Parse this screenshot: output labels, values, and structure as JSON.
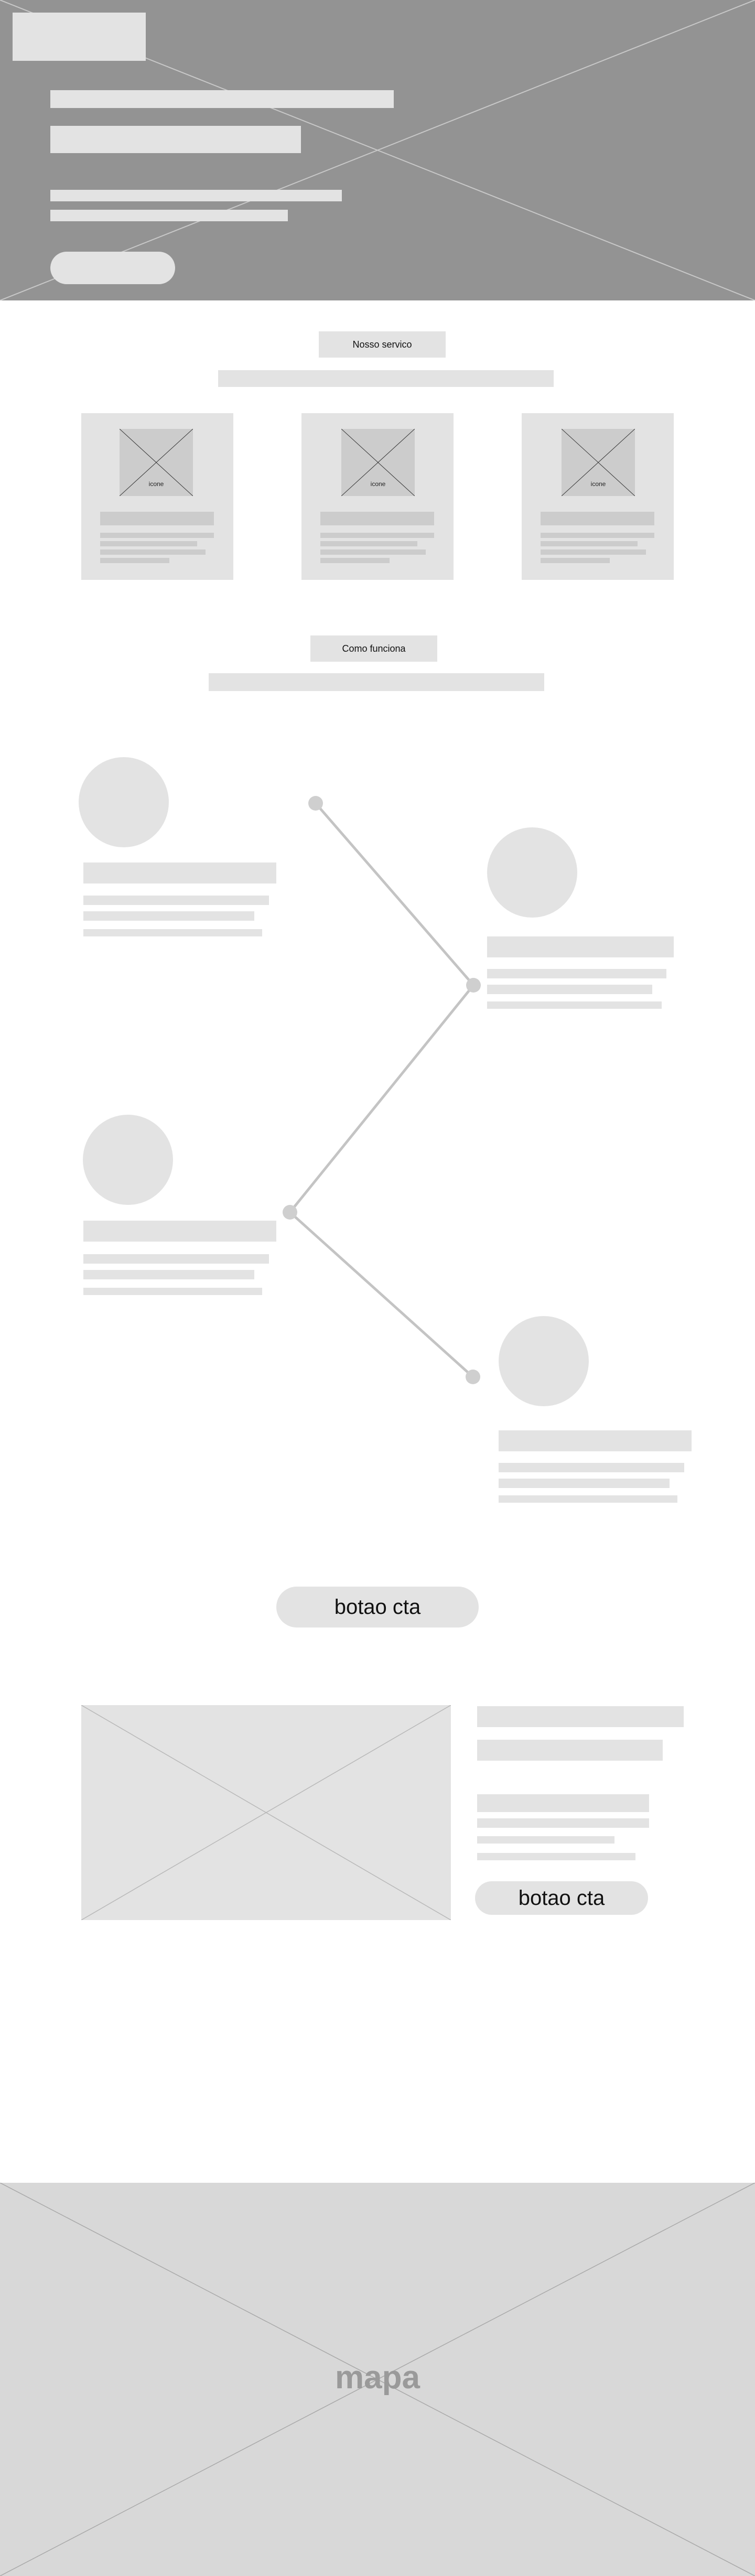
{
  "services": {
    "section_label": "Nosso servico",
    "cards": [
      {
        "image_label": "icone"
      },
      {
        "image_label": "icone"
      },
      {
        "image_label": "icone"
      }
    ]
  },
  "how_it_works": {
    "section_label": "Como funciona",
    "step_count": 4
  },
  "cta_main": {
    "label": "botao cta"
  },
  "feature": {
    "cta_label": "botao cta"
  },
  "map": {
    "label": "mapa"
  },
  "colors": {
    "hero_bg": "#939393",
    "placeholder": "#e3e3e3",
    "placeholder_dark": "#cccccc",
    "map_bg": "#d8d8d8",
    "timeline_line": "#c4c4c4"
  }
}
